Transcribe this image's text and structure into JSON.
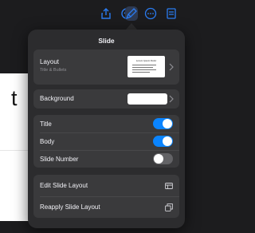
{
  "toolbar": {
    "icons": [
      "share-icon",
      "undo-icon",
      "format-brush-icon",
      "more-icon",
      "document-icon"
    ]
  },
  "canvas": {
    "visible_letter": "t"
  },
  "popover": {
    "title": "Slide",
    "layout": {
      "label": "Layout",
      "sublabel": "Title & Bullets",
      "thumbnail_title": "Lorem Ipsum Dolor"
    },
    "background": {
      "label": "Background",
      "swatch_color": "#ffffff"
    },
    "toggles": [
      {
        "label": "Title",
        "on": true
      },
      {
        "label": "Body",
        "on": true
      },
      {
        "label": "Slide Number",
        "on": false
      }
    ],
    "actions": [
      {
        "label": "Edit Slide Layout",
        "icon": "layout-grid-icon"
      },
      {
        "label": "Reapply Slide Layout",
        "icon": "reapply-copy-icon"
      }
    ],
    "colors": {
      "accent": "#0a84ff",
      "toggle_off": "#636366",
      "panel": "#2c2c2e",
      "group": "#3a3a3c"
    }
  }
}
